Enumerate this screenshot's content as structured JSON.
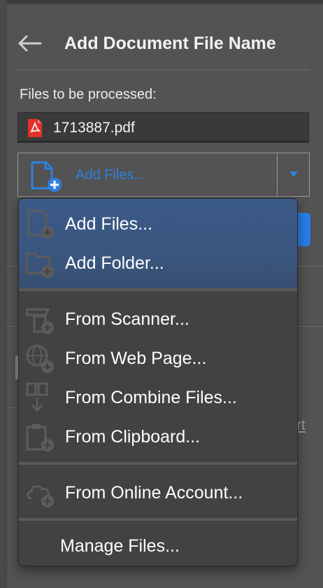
{
  "header": {
    "title": "Add Document File Name"
  },
  "files_section": {
    "label": "Files to be processed:",
    "files": [
      {
        "name": "1713887.pdf",
        "icon": "pdf-file-icon"
      }
    ]
  },
  "add_files_combo": {
    "label": "Add Files..."
  },
  "background": {
    "partial_link_text": "rt"
  },
  "menu": {
    "group1": [
      {
        "label": "Add Files...",
        "icon": "add-file-icon"
      },
      {
        "label": "Add Folder...",
        "icon": "add-folder-icon"
      }
    ],
    "group2": [
      {
        "label": "From Scanner...",
        "icon": "scanner-icon"
      },
      {
        "label": "From Web Page...",
        "icon": "web-page-icon"
      },
      {
        "label": "From Combine Files...",
        "icon": "combine-files-icon"
      },
      {
        "label": "From Clipboard...",
        "icon": "clipboard-icon"
      }
    ],
    "group3": [
      {
        "label": "From Online Account...",
        "icon": "cloud-account-icon"
      }
    ],
    "group4": [
      {
        "label": "Manage Files..."
      }
    ]
  },
  "colors": {
    "accent_blue": "#2f80e0",
    "menu_background": "#424242",
    "menu_highlight": "#3b5a86",
    "panel_background": "#535353",
    "pdf_red": "#e0322a"
  }
}
